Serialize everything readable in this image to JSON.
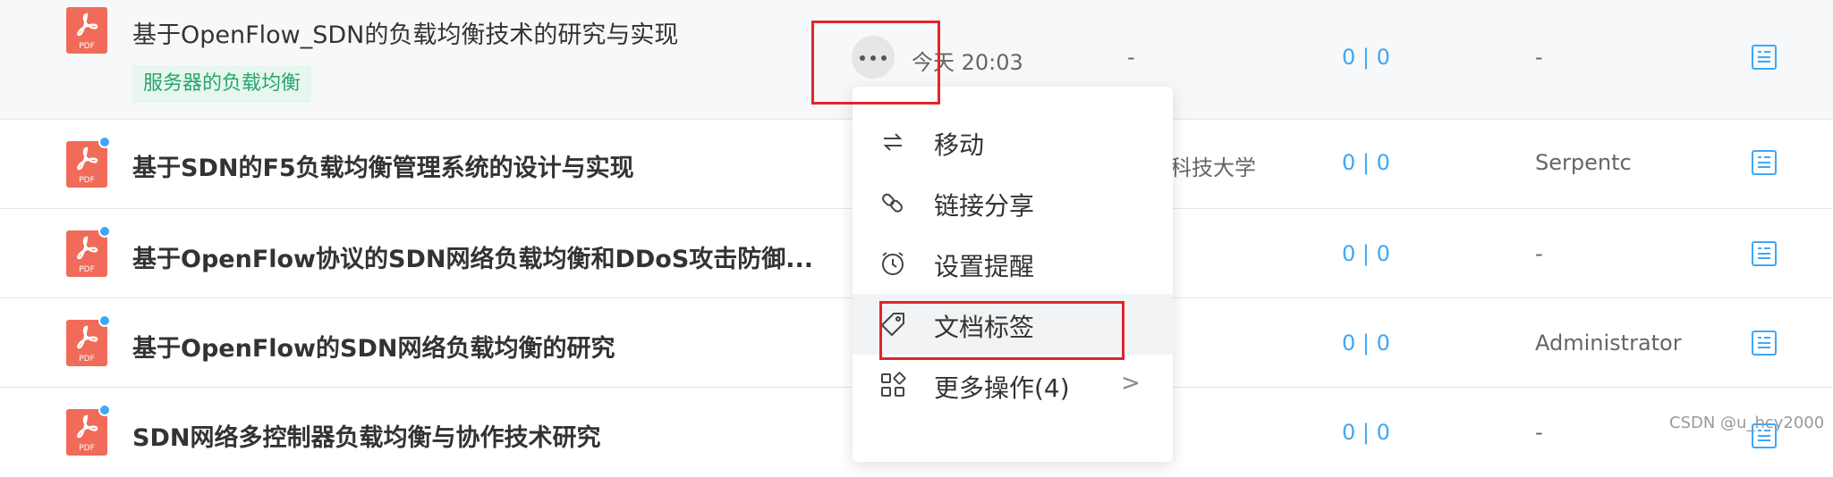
{
  "rows": [
    {
      "title": "基于OpenFlow_SDN的负载均衡技术的研究与实现",
      "tag": "服务器的负载均衡",
      "time": "今天 20:03",
      "source": "-",
      "counts": "0 | 0",
      "author": "-",
      "icon_label": "PDF"
    },
    {
      "title": "基于SDN的F5负载均衡管理系统的设计与实现",
      "source": "科技大学",
      "counts": "0 | 0",
      "author": "Serpentc",
      "icon_label": "PDF"
    },
    {
      "title": "基于OpenFlow协议的SDN网络负载均衡和DDoS攻击防御...",
      "counts": "0 | 0",
      "author": "-",
      "icon_label": "PDF"
    },
    {
      "title": "基于OpenFlow的SDN网络负载均衡的研究",
      "counts": "0 | 0",
      "author": "Administrator",
      "icon_label": "PDF"
    },
    {
      "title": "SDN网络多控制器负载均衡与协作技术研究",
      "counts": "0 | 0",
      "author": "-",
      "icon_label": "PDF"
    }
  ],
  "context_menu": {
    "items": [
      {
        "label": "移动",
        "icon": "move-icon"
      },
      {
        "label": "链接分享",
        "icon": "link-icon"
      },
      {
        "label": "设置提醒",
        "icon": "alarm-clock-icon"
      },
      {
        "label": "文档标签",
        "icon": "tag-icon"
      },
      {
        "label": "更多操作(4)",
        "icon": "grid-icon"
      }
    ],
    "submenu_arrow": ">"
  },
  "watermark": "CSDN @u_hcy2000",
  "colors": {
    "accent": "#3ea8f5",
    "pdf": "#f16b5a",
    "tag_bg": "#e7f6ef",
    "tag_text": "#27a56c",
    "highlight_box": "#e0262b"
  }
}
